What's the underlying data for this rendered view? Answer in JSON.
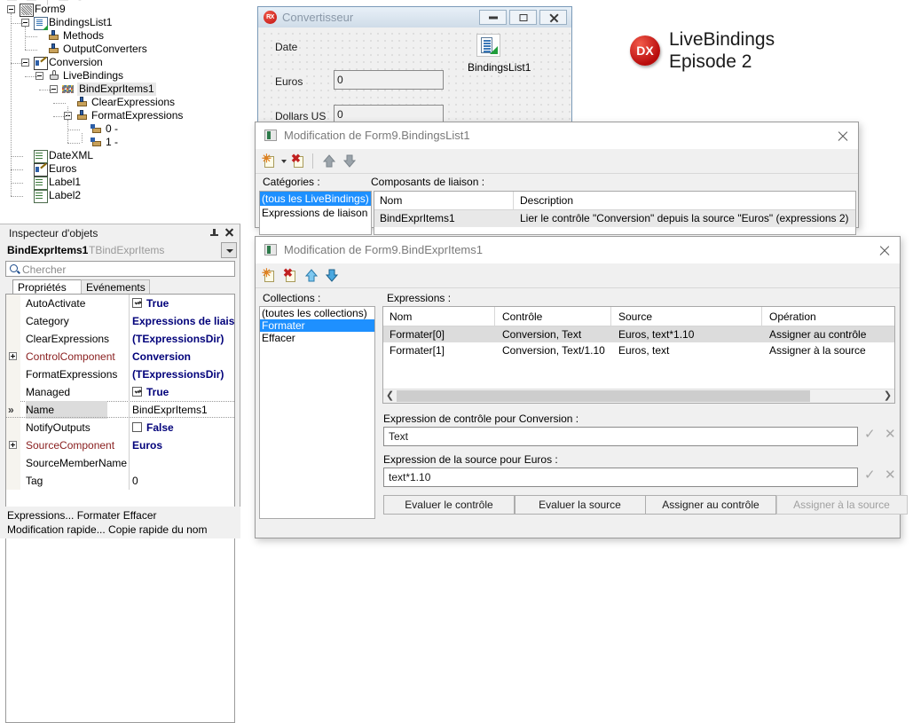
{
  "tree": {
    "name": "structure-tree",
    "nodes": [
      {
        "label": "Form9",
        "depth": 0,
        "icon": "form-icon",
        "expander": "minus",
        "selected": false
      },
      {
        "label": "BindingsList1",
        "depth": 1,
        "icon": "bindings-list-icon",
        "expander": "minus",
        "selected": false
      },
      {
        "label": "Methods",
        "depth": 2,
        "icon": "methods-icon",
        "expander": "none",
        "selected": false
      },
      {
        "label": "OutputConverters",
        "depth": 2,
        "icon": "methods-icon",
        "expander": "none",
        "selected": false
      },
      {
        "label": "Conversion",
        "depth": 1,
        "icon": "edit-control-icon",
        "expander": "minus",
        "selected": false
      },
      {
        "label": "LiveBindings",
        "depth": 2,
        "icon": "livebindings-icon",
        "expander": "minus",
        "selected": false
      },
      {
        "label": "BindExprItems1",
        "depth": 3,
        "icon": "bind-expr-icon",
        "expander": "minus",
        "selected": true
      },
      {
        "label": "ClearExpressions",
        "depth": 4,
        "icon": "methods-icon",
        "expander": "none",
        "selected": false
      },
      {
        "label": "FormatExpressions",
        "depth": 4,
        "icon": "methods-icon",
        "expander": "minus",
        "selected": false
      },
      {
        "label": "0 -",
        "depth": 5,
        "icon": "expression-item-icon",
        "expander": "none",
        "selected": false
      },
      {
        "label": "1 -",
        "depth": 5,
        "icon": "expression-item-icon",
        "expander": "none",
        "selected": false
      },
      {
        "label": "DateXML",
        "depth": 1,
        "icon": "label-icon",
        "expander": "none",
        "selected": false
      },
      {
        "label": "Euros",
        "depth": 1,
        "icon": "edit-control-icon",
        "expander": "none",
        "selected": false
      },
      {
        "label": "Label1",
        "depth": 1,
        "icon": "label-icon",
        "expander": "none",
        "selected": false
      },
      {
        "label": "Label2",
        "depth": 1,
        "icon": "label-icon",
        "expander": "none",
        "selected": false
      }
    ]
  },
  "inspector": {
    "title": "Inspecteur d'objets",
    "object_name": "BindExprItems1",
    "object_type": "TBindExprItems",
    "search_placeholder": "Chercher",
    "tabs": [
      {
        "label": "Propriétés",
        "active": true
      },
      {
        "label": "Evénements",
        "active": false
      }
    ],
    "properties": [
      {
        "name": "AutoActivate",
        "value": "True",
        "kind": "checkbox",
        "checked": true,
        "expandable": false,
        "name_color": "black",
        "selected": false
      },
      {
        "name": "Category",
        "value": "Expressions de liaison",
        "kind": "text",
        "expandable": false,
        "name_color": "black",
        "selected": false
      },
      {
        "name": "ClearExpressions",
        "value": "(TExpressionsDir)",
        "kind": "text",
        "expandable": false,
        "name_color": "black",
        "selected": false
      },
      {
        "name": "ControlComponent",
        "value": "Conversion",
        "kind": "text",
        "expandable": true,
        "name_color": "red",
        "selected": false
      },
      {
        "name": "FormatExpressions",
        "value": "(TExpressionsDir)",
        "kind": "text",
        "expandable": false,
        "name_color": "black",
        "selected": false
      },
      {
        "name": "Managed",
        "value": "True",
        "kind": "checkbox",
        "checked": true,
        "expandable": false,
        "name_color": "black",
        "selected": false
      },
      {
        "name": "Name",
        "value": "BindExprItems1",
        "kind": "plain",
        "expandable": false,
        "name_color": "black",
        "selected": true
      },
      {
        "name": "NotifyOutputs",
        "value": "False",
        "kind": "checkbox",
        "checked": false,
        "expandable": false,
        "name_color": "black",
        "selected": false
      },
      {
        "name": "SourceComponent",
        "value": "Euros",
        "kind": "text",
        "expandable": true,
        "name_color": "red",
        "selected": false
      },
      {
        "name": "SourceMemberName",
        "value": "",
        "kind": "plain",
        "expandable": false,
        "name_color": "black",
        "selected": false
      },
      {
        "name": "Tag",
        "value": "0",
        "kind": "plain",
        "expandable": false,
        "name_color": "black",
        "selected": false
      }
    ],
    "footer_line1": "Expressions...  Formater  Effacer",
    "footer_line2": "Modification rapide...  Copie rapide du nom"
  },
  "designer": {
    "window_title": "Convertisseur",
    "logo_text": "RX",
    "labels": {
      "date": "Date",
      "euros": "Euros",
      "dollars": "Dollars US",
      "bindings_component": "BindingsList1"
    },
    "fields": {
      "euros_value": "0",
      "dollars_value": "0"
    },
    "window_buttons": [
      "minimize",
      "maximize",
      "close"
    ]
  },
  "branding": {
    "badge": "DX",
    "line1": "LiveBindings",
    "line2": "Episode 2",
    "badge_color": "#c01010"
  },
  "dialog_bindings_list": {
    "title": "Modification de Form9.BindingsList1",
    "toolbar": [
      "add-binding-icon",
      "delete-binding-icon",
      "move-up-icon",
      "move-down-icon"
    ],
    "categories_label": "Catégories :",
    "components_label": "Composants de liaison :",
    "categories": [
      {
        "label": "(tous les LiveBindings)",
        "selected": true
      },
      {
        "label": "Expressions de liaison",
        "selected": false
      }
    ],
    "columns": [
      "Nom",
      "Description"
    ],
    "rows": [
      {
        "nom": "BindExprItems1",
        "description": "Lier le contrôle \"Conversion\" depuis la source \"Euros\" (expressions 2)",
        "selected": true
      }
    ]
  },
  "dialog_bind_expr": {
    "title": "Modification de Form9.BindExprItems1",
    "toolbar": [
      "add-expression-icon",
      "delete-expression-icon",
      "move-up-icon",
      "move-down-icon"
    ],
    "collections_label": "Collections :",
    "expressions_label": "Expressions :",
    "collections": [
      {
        "label": "(toutes les collections)",
        "selected": false
      },
      {
        "label": "Formater",
        "selected": true
      },
      {
        "label": "Effacer",
        "selected": false
      }
    ],
    "columns": [
      "Nom",
      "Contrôle",
      "Source",
      "Opération"
    ],
    "rows": [
      {
        "nom": "Formater[0]",
        "controle": "Conversion, Text",
        "source": "Euros, text*1.10",
        "operation": "Assigner au contrôle",
        "selected": true
      },
      {
        "nom": "Formater[1]",
        "controle": "Conversion, Text/1.10",
        "source": "Euros, text",
        "operation": "Assigner à la source",
        "selected": false
      }
    ],
    "control_expression_label": "Expression de contrôle pour Conversion :",
    "control_expression_value": "Text",
    "source_expression_label": "Expression de la source pour Euros :",
    "source_expression_value": "text*1.10",
    "buttons": [
      {
        "label": "Evaluer le contrôle",
        "disabled": false
      },
      {
        "label": "Evaluer la source",
        "disabled": false
      },
      {
        "label": "Assigner au contrôle",
        "disabled": false
      },
      {
        "label": "Assigner à la source",
        "disabled": true
      }
    ]
  }
}
